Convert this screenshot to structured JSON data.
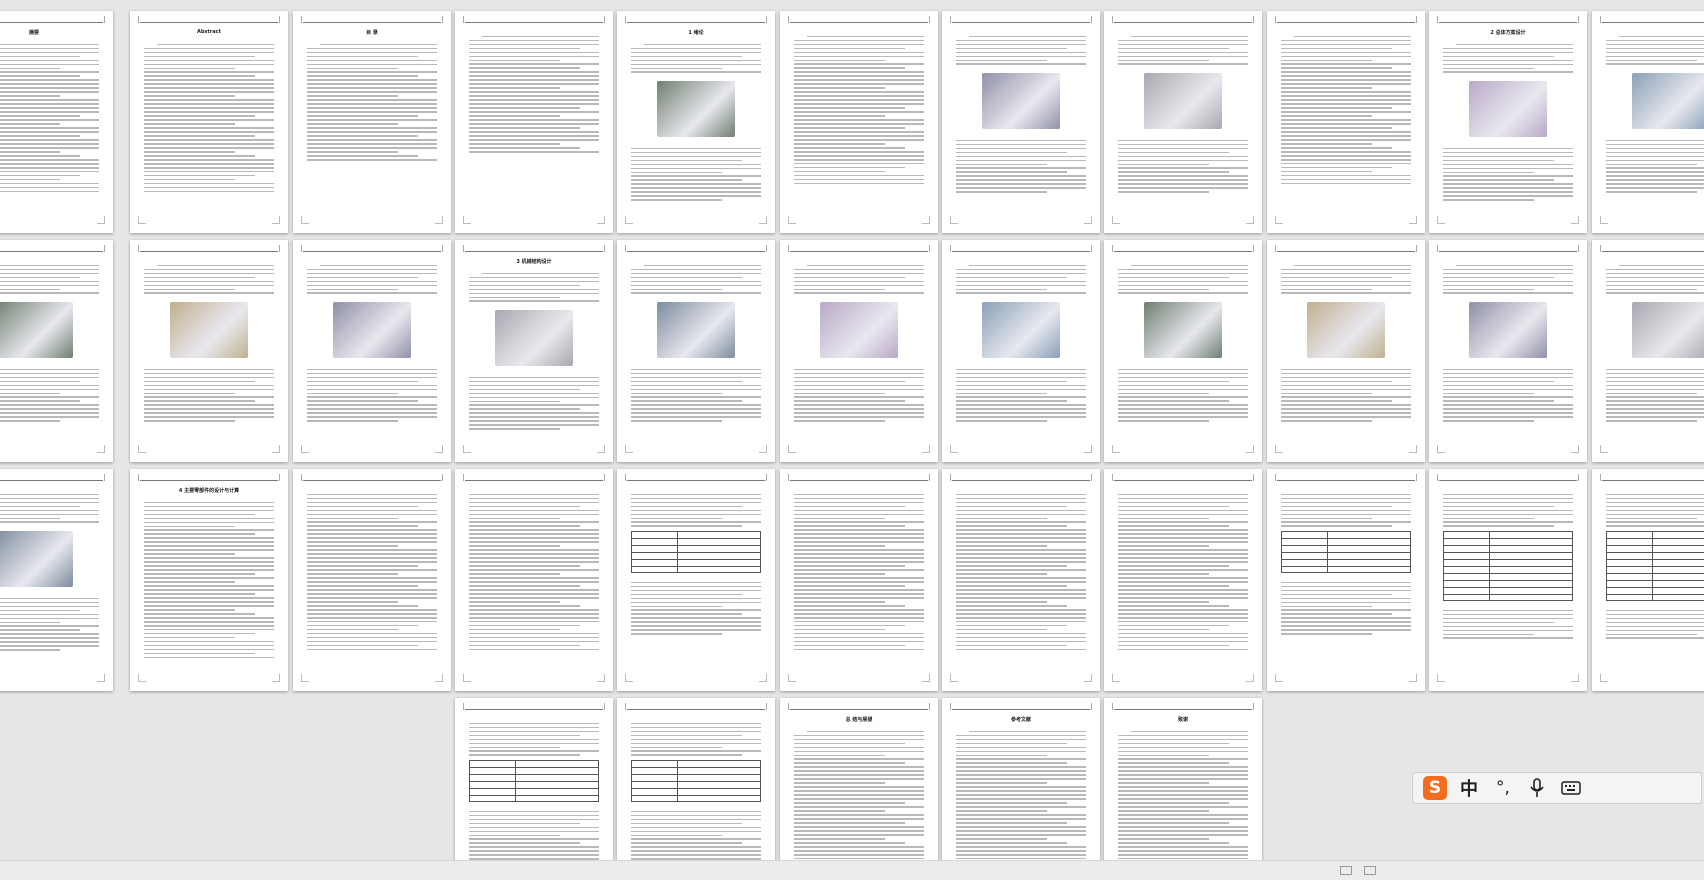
{
  "viewer": {
    "mode": "multi-page thumbnail view",
    "ime_toolbar": {
      "logo": "S",
      "language": "中",
      "punctuation": "°,",
      "mic_icon": "microphone-icon",
      "keyboard_icon": "keyboard-icon"
    }
  },
  "pages": [
    {
      "title": "摘要",
      "kind": "text"
    },
    {
      "title": "Abstract",
      "kind": "text"
    },
    {
      "title": "目 录",
      "kind": "toc"
    },
    {
      "title": "",
      "kind": "toc"
    },
    {
      "title": "1 绪论",
      "kind": "figure-text"
    },
    {
      "title": "",
      "kind": "text"
    },
    {
      "title": "",
      "kind": "figure-text"
    },
    {
      "title": "",
      "kind": "figure-text"
    },
    {
      "title": "",
      "kind": "text"
    },
    {
      "title": "2 总体方案设计",
      "kind": "figure-text"
    },
    {
      "title": "",
      "kind": "figure-text"
    },
    {
      "title": "",
      "kind": "figure-text"
    },
    {
      "title": "",
      "kind": "figure-text"
    },
    {
      "title": "",
      "kind": "figure-text"
    },
    {
      "title": "3 机械结构设计",
      "kind": "figure-text"
    },
    {
      "title": "",
      "kind": "figure-text"
    },
    {
      "title": "",
      "kind": "figure-text"
    },
    {
      "title": "",
      "kind": "figure-text"
    },
    {
      "title": "",
      "kind": "figure-text"
    },
    {
      "title": "",
      "kind": "figure-text"
    },
    {
      "title": "",
      "kind": "figure-text"
    },
    {
      "title": "",
      "kind": "figure-text"
    },
    {
      "title": "",
      "kind": "figure-text"
    },
    {
      "title": "4 主要零部件的设计与计算",
      "kind": "formula"
    },
    {
      "title": "",
      "kind": "formula"
    },
    {
      "title": "",
      "kind": "formula"
    },
    {
      "title": "",
      "kind": "table-figure"
    },
    {
      "title": "",
      "kind": "formula"
    },
    {
      "title": "",
      "kind": "formula"
    },
    {
      "title": "",
      "kind": "formula"
    },
    {
      "title": "",
      "kind": "table-figure"
    },
    {
      "title": "",
      "kind": "table"
    },
    {
      "title": "",
      "kind": "table"
    },
    {
      "title": "",
      "kind": "formula-table"
    },
    {
      "title": "",
      "kind": "formula-table"
    },
    {
      "title": "总 结与展望",
      "kind": "text"
    },
    {
      "title": "参考文献",
      "kind": "text"
    },
    {
      "title": "致谢",
      "kind": "text"
    }
  ]
}
